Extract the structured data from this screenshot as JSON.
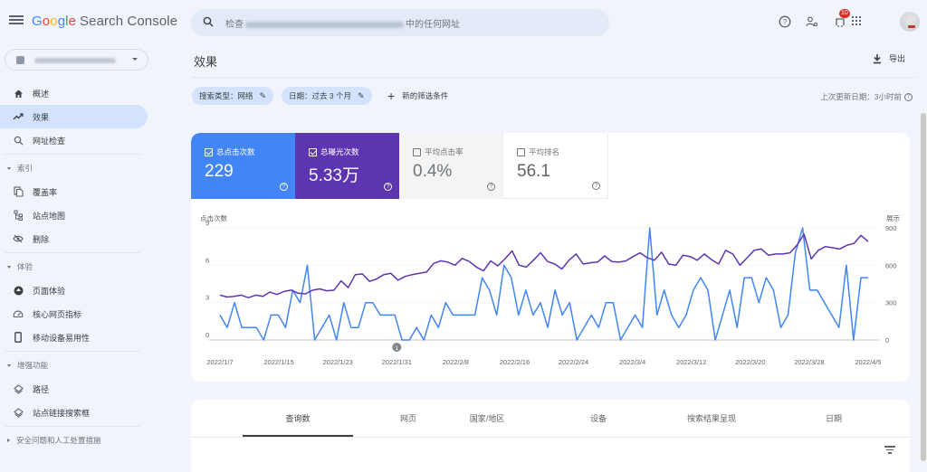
{
  "app": {
    "logo_letters": [
      "G",
      "o",
      "o",
      "g",
      "l",
      "e"
    ],
    "logo_suffix": "Search Console"
  },
  "search": {
    "placeholder_prefix": "检查",
    "placeholder_suffix": "中的任何网址"
  },
  "topbar": {
    "help_icon": "help-circle-icon",
    "users_icon": "manage-users-icon",
    "notifications_icon": "notifications-icon",
    "notifications_count": "10",
    "apps_icon": "apps-grid-icon",
    "avatar_icon": "account-avatar"
  },
  "property_selector": {
    "label": "https://www.rapidw..."
  },
  "sidebar": {
    "items": [
      {
        "label": "概述",
        "icon": "home-icon"
      },
      {
        "label": "效果",
        "icon": "trending-up-icon",
        "active": true
      },
      {
        "label": "网址检查",
        "icon": "search-icon"
      }
    ],
    "sections": [
      {
        "title": "索引",
        "expanded": true,
        "items": [
          {
            "label": "覆盖率",
            "icon": "copy-pages-icon"
          },
          {
            "label": "站点地图",
            "icon": "sitemap-icon"
          },
          {
            "label": "删除",
            "icon": "visibility-off-icon"
          }
        ]
      },
      {
        "title": "体验",
        "expanded": true,
        "items": [
          {
            "label": "页面体验",
            "icon": "page-experience-icon"
          },
          {
            "label": "核心网页指标",
            "icon": "speed-gauge-icon"
          },
          {
            "label": "移动设备易用性",
            "icon": "smartphone-icon"
          }
        ]
      },
      {
        "title": "增强功能",
        "expanded": true,
        "items": [
          {
            "label": "路径",
            "icon": "layers-icon"
          },
          {
            "label": "站点链接搜索框",
            "icon": "layers-icon"
          }
        ]
      },
      {
        "title": "安全问题和人工处置措施",
        "expanded": false,
        "items": []
      }
    ]
  },
  "page": {
    "title": "效果",
    "export_label": "导出",
    "filters": [
      {
        "label": "搜索类型：网络"
      },
      {
        "label": "日期：过去 3 个月"
      }
    ],
    "add_filter_label": "新的筛选条件",
    "last_update": "上次更新日期：3小时前"
  },
  "metrics": [
    {
      "label": "总点击次数",
      "value": "229",
      "checked": true,
      "color": "#4285f4"
    },
    {
      "label": "总曝光次数",
      "value": "5.33万",
      "checked": true,
      "color": "#5e35b1"
    },
    {
      "label": "平均点击率",
      "value": "0.4%",
      "checked": false
    },
    {
      "label": "平均排名",
      "value": "56.1",
      "checked": false
    }
  ],
  "chart_data": {
    "type": "line",
    "title": "",
    "xlabel": "",
    "ylabel_left": "点击次数",
    "ylabel_right": "展示",
    "ylim_left": [
      0,
      9
    ],
    "ylim_right": [
      0,
      900
    ],
    "yticks_left": [
      "0",
      "3",
      "6",
      "9"
    ],
    "yticks_right": [
      "0",
      "300",
      "600",
      "900"
    ],
    "x_tick_labels": [
      "2022/1/7",
      "2022/1/15",
      "2022/1/23",
      "2022/1/31",
      "2022/2/8",
      "2022/2/16",
      "2022/2/24",
      "2022/3/4",
      "2022/3/12",
      "2022/3/20",
      "2022/3/28",
      "2022/4/5"
    ],
    "x_start": "2022/1/7",
    "x_end": "2022/4/5",
    "annotation": {
      "date": "2022/1/31",
      "label": "1"
    },
    "grid": true,
    "series": [
      {
        "name": "点击次数",
        "axis": "left",
        "color": "#4285f4",
        "values": [
          2,
          1,
          3,
          1,
          1,
          1,
          0,
          2,
          2,
          1,
          4,
          3,
          6,
          0,
          1,
          2,
          0,
          3,
          1,
          1,
          3,
          3,
          2,
          2,
          2,
          0,
          0,
          1,
          0,
          2,
          1,
          3,
          2,
          2,
          2,
          2,
          5,
          4,
          2,
          6,
          5,
          2,
          4,
          2,
          3,
          1,
          4,
          2,
          3,
          0,
          1,
          2,
          1,
          3,
          3,
          0,
          1,
          2,
          1,
          9,
          2,
          4,
          2,
          1,
          2,
          4,
          5,
          4,
          0,
          2,
          4,
          1,
          5,
          5,
          3,
          5,
          4,
          1,
          2,
          7,
          9,
          4,
          4,
          3,
          2,
          1,
          6,
          0,
          5,
          5
        ]
      },
      {
        "name": "展示",
        "axis": "right",
        "color": "#5e35b1",
        "values": [
          360,
          345,
          350,
          360,
          340,
          360,
          350,
          385,
          365,
          390,
          400,
          375,
          370,
          400,
          410,
          395,
          400,
          475,
          420,
          525,
          530,
          470,
          490,
          525,
          535,
          480,
          510,
          525,
          535,
          545,
          615,
          635,
          625,
          600,
          655,
          630,
          585,
          555,
          635,
          595,
          650,
          715,
          600,
          585,
          640,
          700,
          630,
          610,
          570,
          640,
          690,
          610,
          620,
          625,
          675,
          630,
          625,
          635,
          670,
          700,
          660,
          640,
          705,
          610,
          600,
          680,
          670,
          640,
          690,
          645,
          610,
          720,
          690,
          600,
          660,
          720,
          730,
          680,
          690,
          690,
          700,
          760,
          850,
          650,
          720,
          750,
          740,
          730,
          760,
          775,
          840,
          790
        ]
      }
    ]
  },
  "tabs": [
    {
      "label": "查询数",
      "active": true
    },
    {
      "label": "网页"
    },
    {
      "label": "国家/地区"
    },
    {
      "label": "设备"
    },
    {
      "label": "搜索结果呈现"
    },
    {
      "label": "日期"
    }
  ]
}
